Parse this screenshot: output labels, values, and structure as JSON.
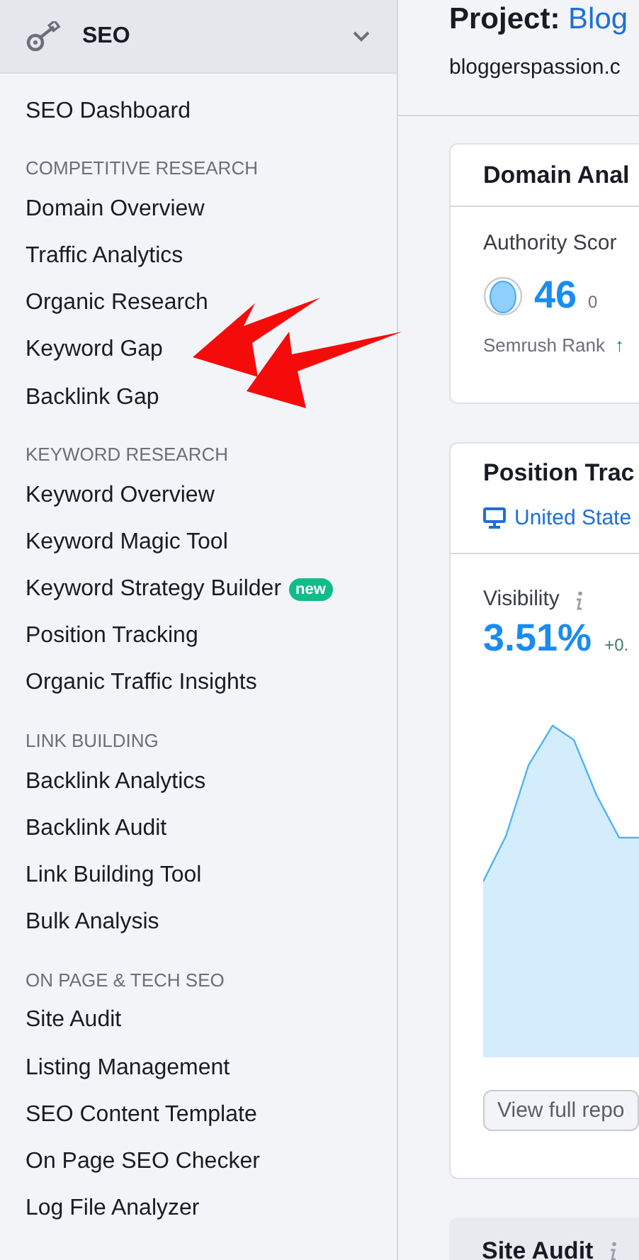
{
  "sidebar": {
    "header": {
      "title": "SEO",
      "expanded": true
    },
    "sections": [
      {
        "items": [
          {
            "label": "SEO Dashboard"
          }
        ]
      },
      {
        "heading": "COMPETITIVE RESEARCH",
        "items": [
          {
            "label": "Domain Overview"
          },
          {
            "label": "Traffic Analytics"
          },
          {
            "label": "Organic Research"
          },
          {
            "label": "Keyword Gap"
          },
          {
            "label": "Backlink Gap"
          }
        ]
      },
      {
        "heading": "KEYWORD RESEARCH",
        "items": [
          {
            "label": "Keyword Overview"
          },
          {
            "label": "Keyword Magic Tool"
          },
          {
            "label": "Keyword Strategy Builder",
            "badge": "new"
          },
          {
            "label": "Position Tracking"
          },
          {
            "label": "Organic Traffic Insights"
          }
        ]
      },
      {
        "heading": "LINK BUILDING",
        "items": [
          {
            "label": "Backlink Analytics"
          },
          {
            "label": "Backlink Audit"
          },
          {
            "label": "Link Building Tool"
          },
          {
            "label": "Bulk Analysis"
          }
        ]
      },
      {
        "heading": "ON PAGE & TECH SEO",
        "items": [
          {
            "label": "Site Audit"
          },
          {
            "label": "Listing Management"
          },
          {
            "label": "SEO Content Template"
          },
          {
            "label": "On Page SEO Checker"
          },
          {
            "label": "Log File Analyzer"
          }
        ]
      }
    ]
  },
  "project": {
    "prefix": "Project:",
    "name": "Blog",
    "domain": "bloggerspassion.c"
  },
  "domain_card": {
    "title": "Domain Anal",
    "metric_label": "Authority Scor",
    "score": "46",
    "change": "0",
    "rank_label": "Semrush Rank",
    "rank_arrow": "↑"
  },
  "position_card": {
    "title": "Position Trac",
    "location": "United State",
    "metric_label": "Visibility",
    "value": "3.51%",
    "change": "+0.",
    "button": "View full repo"
  },
  "site_audit_card": {
    "title": "Site Audit"
  }
}
